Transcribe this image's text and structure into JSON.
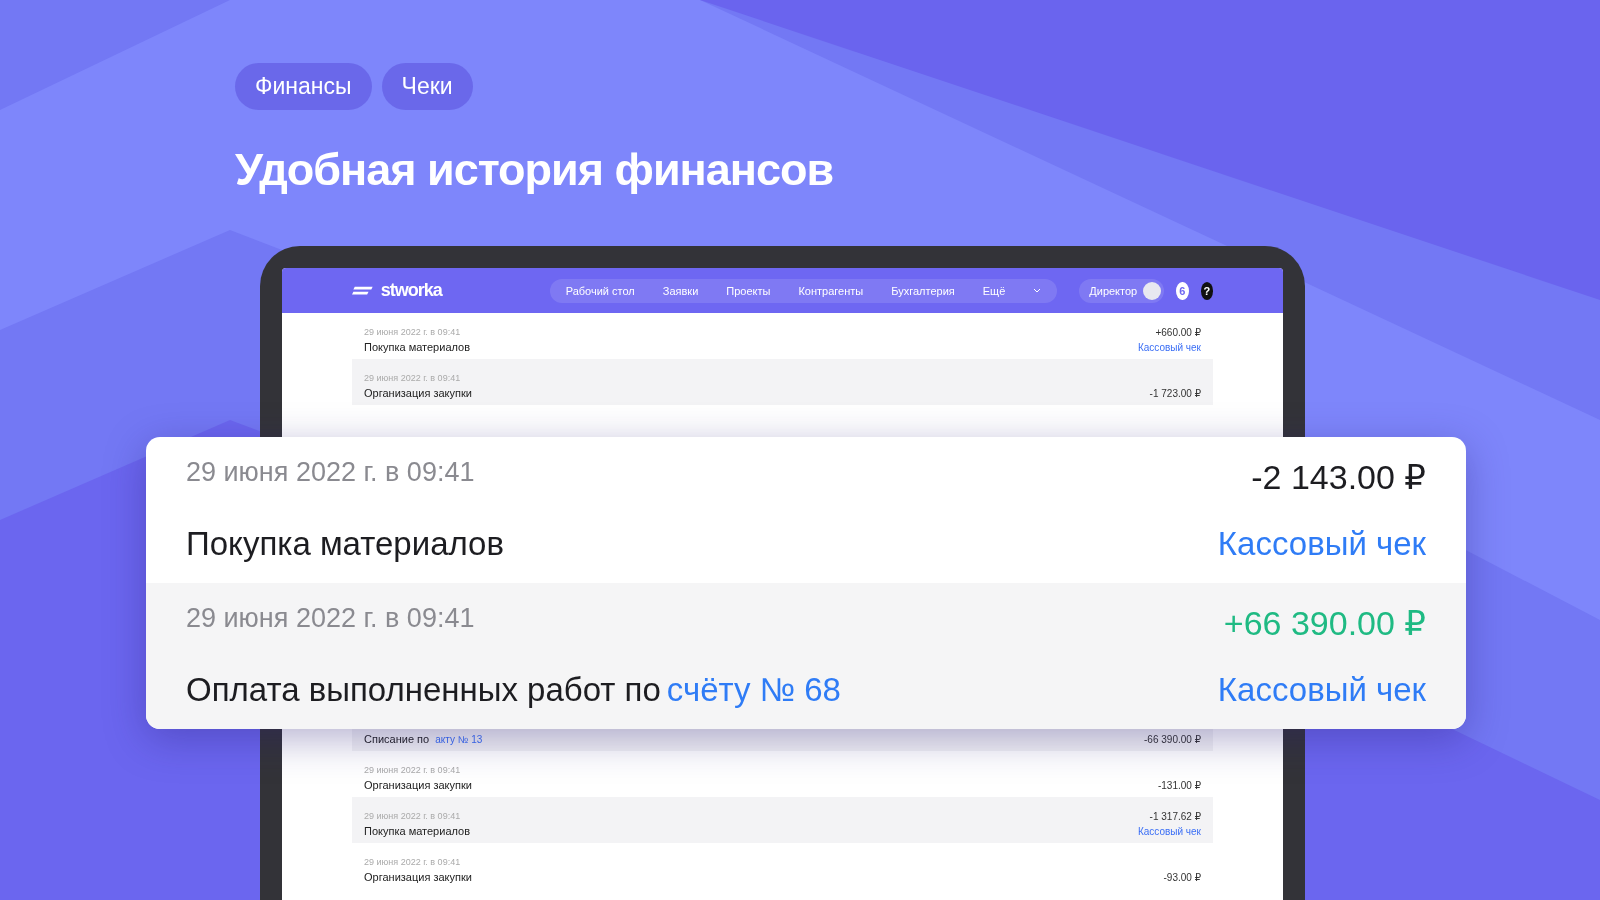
{
  "tags": [
    {
      "label": "Финансы"
    },
    {
      "label": "Чеки"
    }
  ],
  "headline": "Удобная история финансов",
  "app": {
    "logo": "stworka",
    "nav": [
      {
        "label": "Рабочий стол"
      },
      {
        "label": "Заявки"
      },
      {
        "label": "Проекты"
      },
      {
        "label": "Контрагенты"
      },
      {
        "label": "Бухгалтерия"
      },
      {
        "label": "Ещё"
      }
    ],
    "role": "Директор",
    "badge": "6",
    "help": "?",
    "rows_above": [
      {
        "date": "29 июня 2022 г. в 09:41",
        "title": "Покупка материалов",
        "amount": "+660.00 ₽",
        "receipt": "Кассовый чек"
      },
      {
        "date": "29 июня 2022 г. в 09:41",
        "title": "Организация закупки",
        "amount": "-1 723.00 ₽"
      }
    ],
    "rows_below": [
      {
        "title": "Списание по",
        "link": "акту № 13",
        "amount": "-66 390.00 ₽"
      },
      {
        "date": "29 июня 2022 г. в 09:41",
        "title": "Организация закупки",
        "amount": "-131.00 ₽"
      },
      {
        "date": "29 июня 2022 г. в 09:41",
        "title": "Покупка материалов",
        "amount": "-1 317.62 ₽",
        "receipt": "Кассовый чек"
      },
      {
        "date": "29 июня 2022 г. в 09:41",
        "title": "Организация закупки",
        "amount": "-93.00 ₽"
      }
    ]
  },
  "card": [
    {
      "kind": "expense",
      "date": "29 июня 2022 г. в 09:41",
      "title": "Покупка материалов",
      "amount": "-2 143.00 ₽",
      "receipt": "Кассовый чек"
    },
    {
      "kind": "income",
      "date": "29 июня 2022 г. в 09:41",
      "title": "Оплата выполненных работ по",
      "link": "счёту № 68",
      "amount": "+66 390.00 ₽",
      "receipt": "Кассовый чек"
    }
  ]
}
